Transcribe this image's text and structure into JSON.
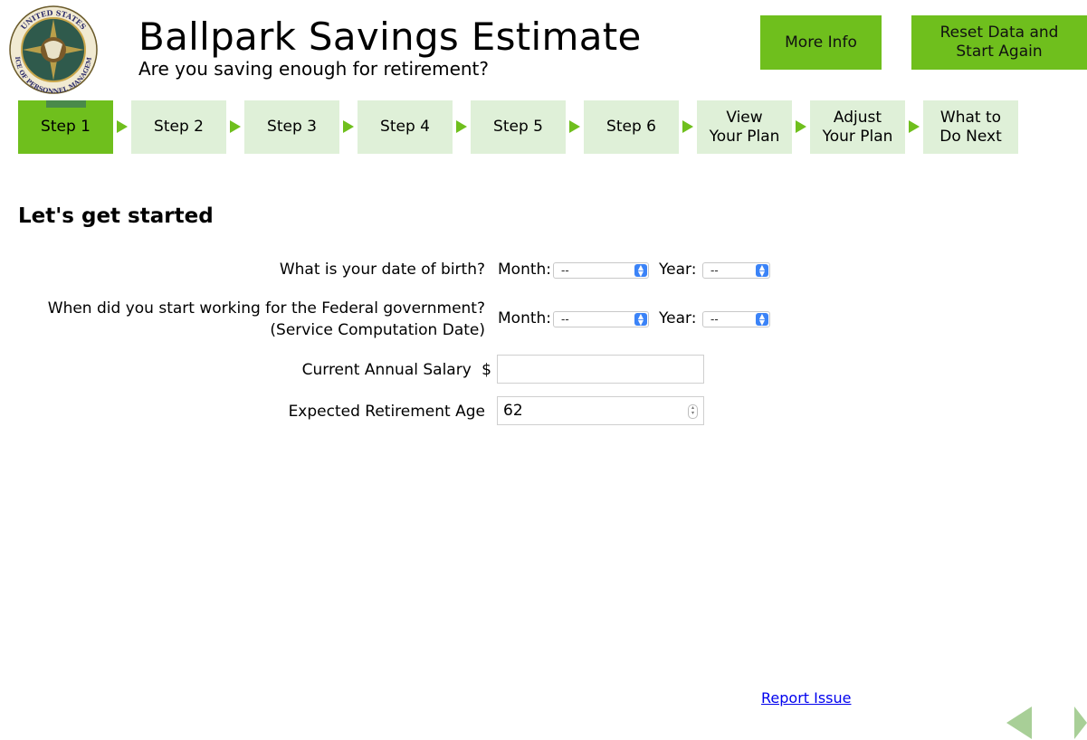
{
  "header": {
    "title": "Ballpark Savings Estimate",
    "subtitle": "Are you saving enough for retirement?",
    "more_info_label": "More Info",
    "reset_label_line1": "Reset Data and",
    "reset_label_line2": "Start Again",
    "seal_top_text": "UNITED STATES",
    "seal_bottom_text": "OFFICE OF PERSONNEL MANAGEMENT"
  },
  "steps": [
    {
      "line1": "Step 1",
      "line2": "",
      "active": true
    },
    {
      "line1": "Step 2",
      "line2": "",
      "active": false
    },
    {
      "line1": "Step 3",
      "line2": "",
      "active": false
    },
    {
      "line1": "Step 4",
      "line2": "",
      "active": false
    },
    {
      "line1": "Step 5",
      "line2": "",
      "active": false
    },
    {
      "line1": "Step 6",
      "line2": "",
      "active": false
    },
    {
      "line1": "View",
      "line2": "Your Plan",
      "active": false
    },
    {
      "line1": "Adjust",
      "line2": "Your Plan",
      "active": false
    },
    {
      "line1": "What to",
      "line2": "Do Next",
      "active": false
    }
  ],
  "form": {
    "section_title": "Let's get started",
    "dob": {
      "question": "What is your date of birth?",
      "month_label": "Month:",
      "month_value": "--",
      "year_label": "Year:",
      "year_value": "--"
    },
    "service": {
      "question_line1": "When did you start working for the Federal government?",
      "question_line2": "(Service Computation Date)",
      "month_label": "Month:",
      "month_value": "--",
      "year_label": "Year:",
      "year_value": "--"
    },
    "salary": {
      "label": "Current Annual Salary",
      "currency": "$",
      "value": ""
    },
    "retirement_age": {
      "label": "Expected Retirement Age",
      "value": "62"
    }
  },
  "footer": {
    "report_issue": "Report Issue"
  },
  "colors": {
    "accent_green": "#6fbf1d",
    "step_inactive": "#dff0d8",
    "nav_arrow": "#a8cf97",
    "link_blue": "#0000ee"
  }
}
